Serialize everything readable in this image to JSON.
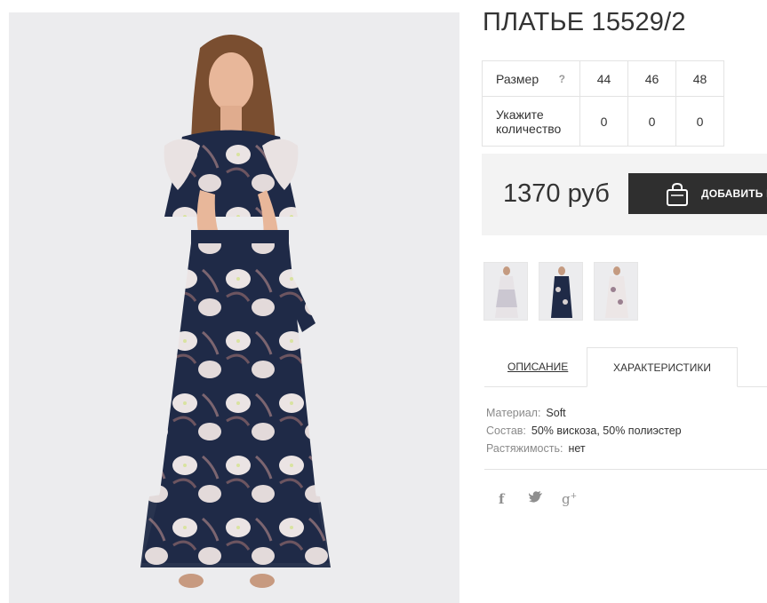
{
  "product": {
    "title": "ПЛАТЬЕ 15529/2",
    "size_label": "Размер",
    "size_help": "?",
    "sizes": [
      "44",
      "46",
      "48"
    ],
    "qty_label": "Укажите количество",
    "quantities": [
      "0",
      "0",
      "0"
    ],
    "price": "1370 руб",
    "add_button": "ДОБАВИТЬ В"
  },
  "tabs": {
    "description": "ОПИСАНИЕ",
    "characteristics": "ХАРАКТЕРИСТИКИ"
  },
  "properties": [
    {
      "key": "Материал:",
      "value": "Soft"
    },
    {
      "key": "Состав:",
      "value": "50% вискоза, 50% полиэстер"
    },
    {
      "key": "Растяжимость:",
      "value": "нет"
    }
  ],
  "social": {
    "facebook": "f",
    "twitter": "twitter-bird",
    "google_plus": "g+"
  },
  "colors": {
    "dress_navy": "#1f2a47",
    "flower": "#e9e2e2",
    "button": "#2f2f2f",
    "price_bg": "#f3f3f3"
  }
}
